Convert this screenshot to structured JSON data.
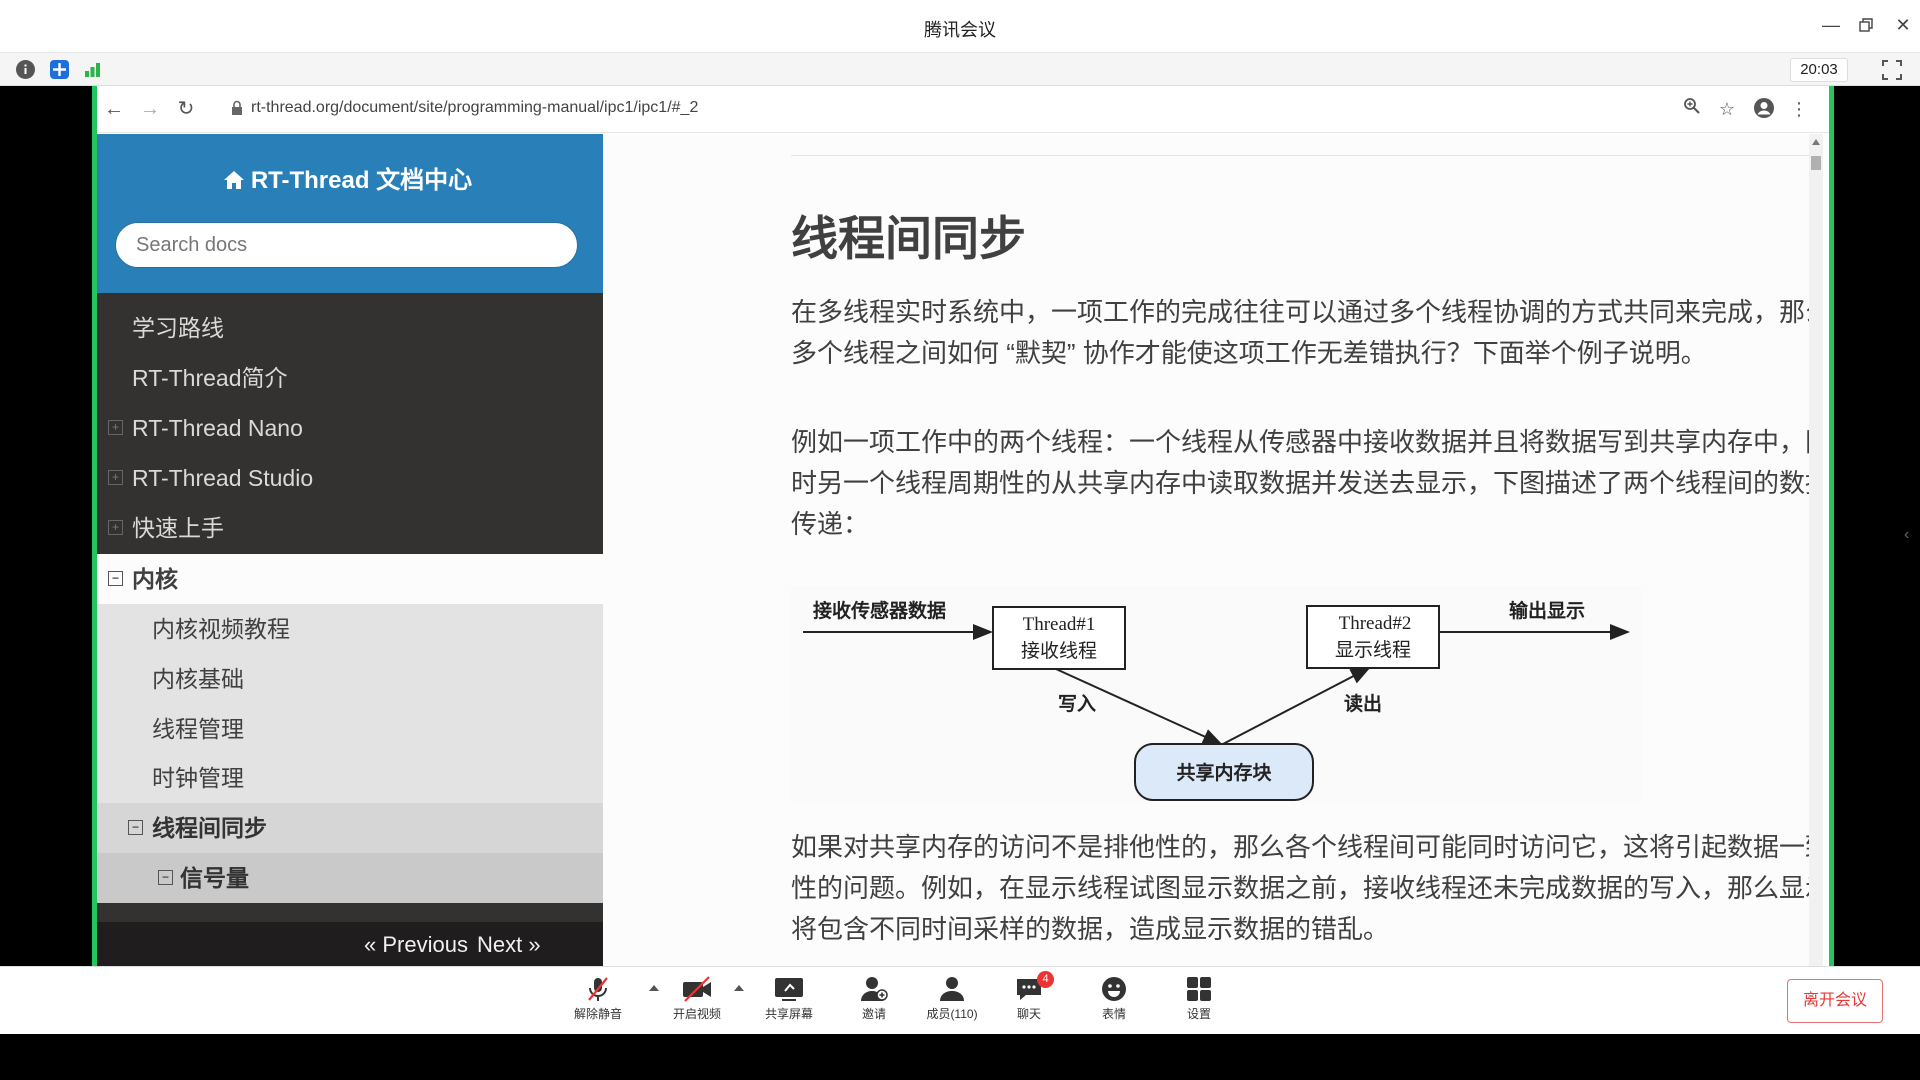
{
  "window": {
    "title": "腾讯会议",
    "timer": "20:03"
  },
  "browser": {
    "url": "rt-thread.org/document/site/programming-manual/ipc1/ipc1/#_2"
  },
  "sidebar": {
    "brand": "RT-Thread 文档中心",
    "search_placeholder": "Search docs",
    "items": [
      {
        "label": "学习路线"
      },
      {
        "label": "RT-Thread简介"
      },
      {
        "label": "RT-Thread Nano"
      },
      {
        "label": "RT-Thread Studio"
      },
      {
        "label": "快速上手"
      },
      {
        "label": "内核"
      },
      {
        "label": "内核视频教程"
      },
      {
        "label": "内核基础"
      },
      {
        "label": "线程管理"
      },
      {
        "label": "时钟管理"
      },
      {
        "label": "线程间同步"
      },
      {
        "label": "信号量"
      }
    ],
    "previous": "« Previous",
    "next": "Next »"
  },
  "content": {
    "heading": "线程间同步",
    "para1": "在多线程实时系统中，一项工作的完成往往可以通过多个线程协调的方式共同来完成，那么多个线程之间如何 “默契” 协作才能使这项工作无差错执行？下面举个例子说明。",
    "para2": "例如一项工作中的两个线程：一个线程从传感器中接收数据并且将数据写到共享内存中，同时另一个线程周期性的从共享内存中读取数据并发送去显示，下图描述了两个线程间的数据传递：",
    "para3": "如果对共享内存的访问不是排他性的，那么各个线程间可能同时访问它，这将引起数据一致性的问题。例如，在显示线程试图显示数据之前，接收线程还未完成数据的写入，那么显示将包含不同时间采样的数据，造成显示数据的错乱。",
    "diagram": {
      "input_label": "接收传感器数据",
      "thread1_line1": "Thread#1",
      "thread1_line2": "接收线程",
      "thread2_line1": "Thread#2",
      "thread2_line2": "显示线程",
      "output_label": "输出显示",
      "write_label": "写入",
      "read_label": "读出",
      "shared_label": "共享内存块"
    }
  },
  "toolbar": {
    "unmute": "解除静音",
    "video": "开启视频",
    "share": "共享屏幕",
    "invite": "邀请",
    "members": "成员(110)",
    "chat": "聊天",
    "chat_badge": "4",
    "emoji": "表情",
    "settings": "设置",
    "leave": "离开会议"
  },
  "colors": {
    "sidebar_header": "#2980b9",
    "sidebar_bg": "#343131",
    "share_border": "#22c55e",
    "leave_red": "#e53935"
  }
}
